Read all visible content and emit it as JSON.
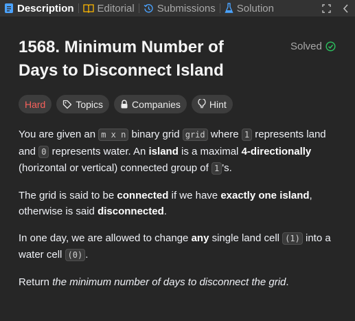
{
  "tabs": {
    "description": "Description",
    "editorial": "Editorial",
    "submissions": "Submissions",
    "solutions": "Solution"
  },
  "problem": {
    "title": "1568. Minimum Number of Days to Disconnect Island",
    "status": "Solved",
    "difficulty": "Hard",
    "chips": {
      "topics": "Topics",
      "companies": "Companies",
      "hint": "Hint"
    }
  },
  "description": {
    "p1": {
      "t1": "You are given an ",
      "c1": "m x n",
      "t2": " binary grid ",
      "c2": "grid",
      "t3": " where ",
      "c3": "1",
      "t4": " represents land and ",
      "c4": "0",
      "t5": " represents water. An ",
      "b1": "island",
      "t6": " is a maximal ",
      "b2": "4-directionally",
      "t7": " (horizontal or vertical) connected group of ",
      "c5": "1",
      "t8": "'s."
    },
    "p2": {
      "t1": "The grid is said to be ",
      "b1": "connected",
      "t2": " if we have ",
      "b2": "exactly one island",
      "t3": ", otherwise is said ",
      "b3": "disconnected",
      "t4": "."
    },
    "p3": {
      "t1": "In one day, we are allowed to change ",
      "b1": "any",
      "t2": " single land cell ",
      "c1": "(1)",
      "t3": " into a water cell ",
      "c2": "(0)",
      "t4": "."
    },
    "p4": {
      "t1": "Return ",
      "i1": "the minimum number of days to disconnect the grid",
      "t2": "."
    }
  },
  "colors": {
    "accent_blue": "#4ba3ff",
    "solved_green": "#2cbb5d",
    "hard_red": "#f8615c"
  }
}
